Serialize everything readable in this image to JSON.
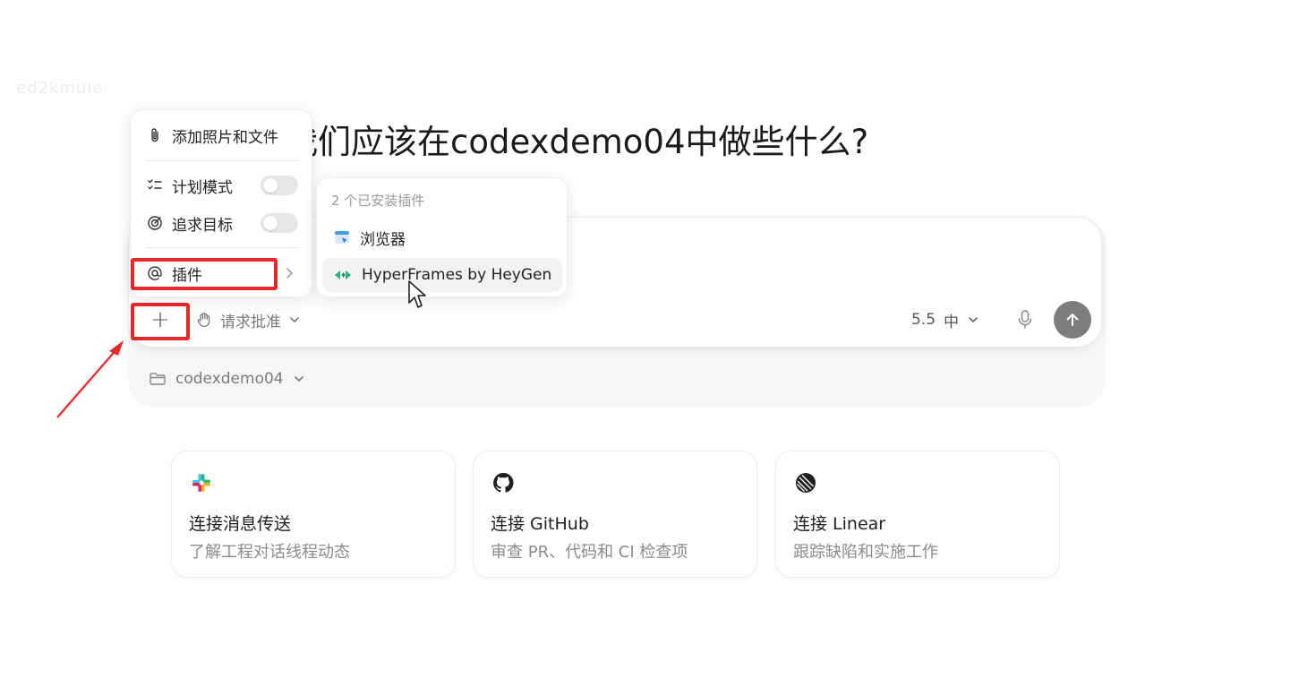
{
  "watermark": "ed2kmule",
  "headline": "我们应该在codexdemo04中做些什么?",
  "composer": {
    "approval_label": "请求批准",
    "model_version": "5.5",
    "model_level": "中",
    "project_label": "codexdemo04"
  },
  "menu": {
    "add_files": "添加照片和文件",
    "plan_mode": "计划模式",
    "pursue_goal": "追求目标",
    "plugins": "插件"
  },
  "submenu": {
    "title": "2 个已安装插件",
    "items": [
      {
        "label": "浏览器"
      },
      {
        "label": "HyperFrames by HeyGen"
      }
    ]
  },
  "cards": [
    {
      "title": "连接消息传送",
      "subtitle": "了解工程对话线程动态",
      "icon": "slack-icon"
    },
    {
      "title": "连接 GitHub",
      "subtitle": "审查 PR、代码和 CI 检查项",
      "icon": "github-icon"
    },
    {
      "title": "连接 Linear",
      "subtitle": "跟踪缺陷和实施工作",
      "icon": "linear-icon"
    }
  ],
  "colors": {
    "highlight_red": "#e8262a",
    "send_button": "#7d7d7d",
    "toggle_off": "#e6e6e6"
  }
}
